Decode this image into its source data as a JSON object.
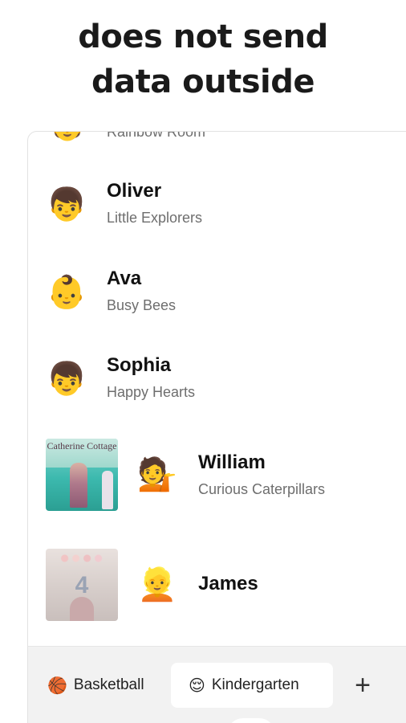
{
  "headline": {
    "line1": "does not send",
    "line2": "data outside"
  },
  "list": {
    "partial_item": {
      "emoji": "🧒",
      "group": "Rainbow Room"
    },
    "items": [
      {
        "emoji": "👦",
        "name": "Oliver",
        "group": "Little Explorers"
      },
      {
        "emoji": "👶",
        "name": "Ava",
        "group": "Busy Bees"
      },
      {
        "emoji": "👦",
        "name": "Sophia",
        "group": "Happy Hearts"
      },
      {
        "emoji": "💁",
        "name": "William",
        "group": "Curious Caterpillars",
        "thumb": "Catherine Cottage"
      },
      {
        "emoji": "👱",
        "name": "James",
        "group": "",
        "thumb": "4"
      }
    ]
  },
  "tabbar": {
    "tabs": [
      {
        "icon": "🏀",
        "label": "Basketball",
        "active": false
      },
      {
        "icon": "😌",
        "label": "Kindergarten",
        "active": true
      }
    ],
    "add_label": "+"
  }
}
